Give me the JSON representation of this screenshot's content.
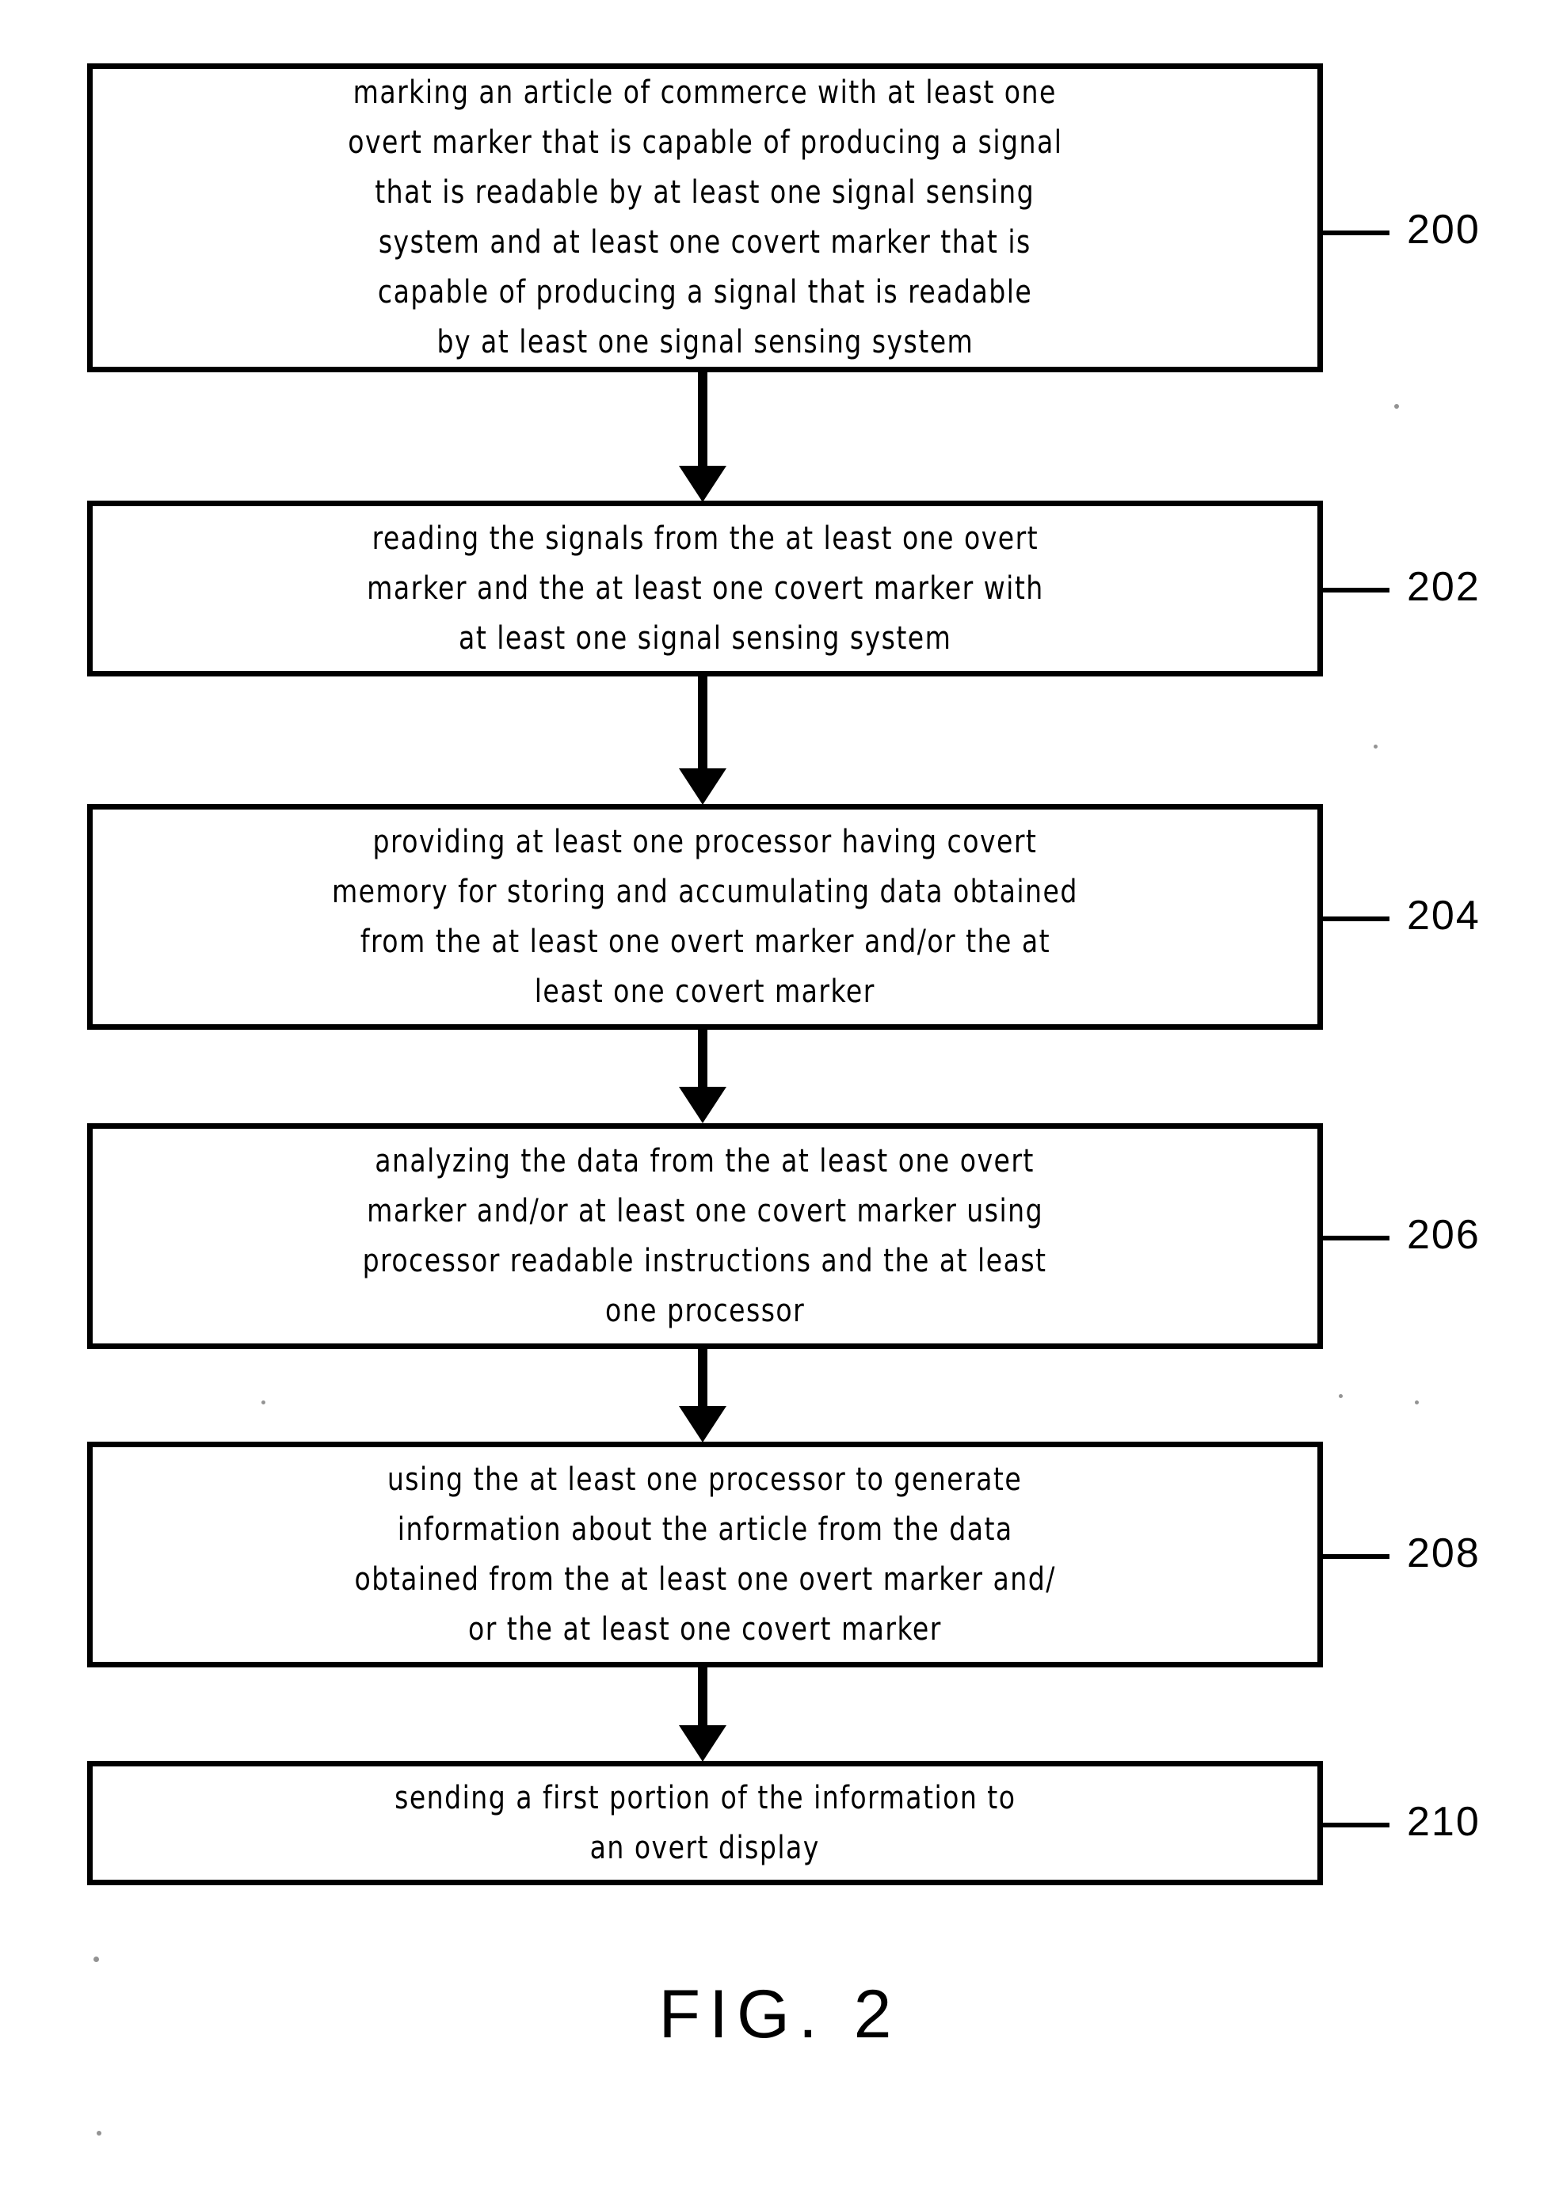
{
  "figure": {
    "caption": "FIG. 2",
    "type": "patent-flowchart",
    "steps": [
      {
        "ref": "200",
        "lines": [
          "marking an article of commerce with at least one",
          "overt marker that is capable of producing a signal",
          "that is readable by at least one signal sensing",
          "system and at least one covert marker that is",
          "capable of producing a signal that is readable",
          "by at least one signal sensing system"
        ],
        "text": "marking an article of commerce with at least one overt marker that is capable of producing a signal that is readable by at least one signal sensing system and at least one covert marker that is capable of producing a signal that is readable by at least one signal sensing system"
      },
      {
        "ref": "202",
        "lines": [
          "reading the signals from the at least one overt",
          "marker and the at least one covert marker with",
          "at least one signal sensing system"
        ],
        "text": "reading the signals from the at least one overt marker and the at least one covert marker with at least one signal sensing system"
      },
      {
        "ref": "204",
        "lines": [
          "providing at least one processor having covert",
          "memory for storing and accumulating data obtained",
          "from the at least one overt marker and/or the at",
          "least one covert marker"
        ],
        "text": "providing at least one processor having covert memory for storing and accumulating data obtained from the at least one overt marker and/or the at least one covert marker"
      },
      {
        "ref": "206",
        "lines": [
          "analyzing the data from the at least one overt",
          "marker and/or at least one covert marker using",
          "processor readable instructions and the at least",
          "one processor"
        ],
        "text": "analyzing the data from the at least one overt marker and/or at least one covert marker using processor readable instructions and the at least one processor"
      },
      {
        "ref": "208",
        "lines": [
          "using the at least one processor to generate",
          "information about the article from the data",
          "obtained from the at least one overt marker and/",
          "or the at least one covert marker"
        ],
        "text": "using the at least one processor to generate information about the article from the data obtained from the at least one overt marker and/or the at least one covert marker"
      },
      {
        "ref": "210",
        "lines": [
          "sending a first portion of the information to",
          "an overt display"
        ],
        "text": "sending a first portion of the information to an overt display"
      }
    ]
  },
  "colors": {
    "ink": "#000000",
    "paper": "#ffffff"
  }
}
